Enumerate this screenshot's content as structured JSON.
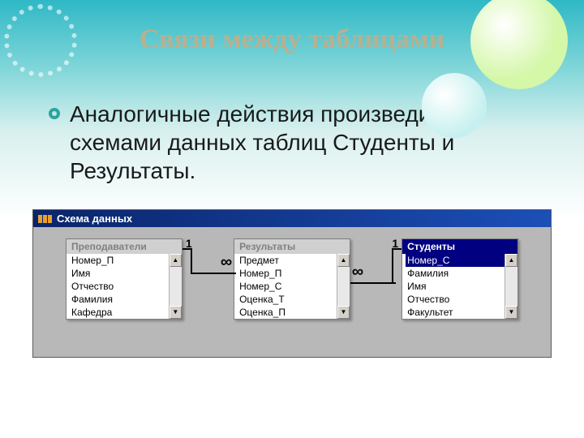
{
  "slide": {
    "title": "Связи между таблицами",
    "body": "Аналогичные действия произведите с схемами данных таблиц Студенты и Результаты."
  },
  "window": {
    "title": "Схема данных"
  },
  "tables": [
    {
      "name": "Преподаватели",
      "fields": [
        "Номер_П",
        "Имя",
        "Отчество",
        "Фамилия",
        "Кафедра"
      ],
      "selected": false
    },
    {
      "name": "Результаты",
      "fields": [
        "Предмет",
        "Номер_П",
        "Номер_С",
        "Оценка_Т",
        "Оценка_П"
      ],
      "selected": false
    },
    {
      "name": "Студенты",
      "fields": [
        "Номер_С",
        "Фамилия",
        "Имя",
        "Отчество",
        "Факультет"
      ],
      "selected": true,
      "selectedField": 0
    }
  ],
  "relations": [
    {
      "left_card": "1",
      "right_card": "∞"
    },
    {
      "left_card": "1",
      "right_card": "∞"
    }
  ],
  "scroll": {
    "up": "▲",
    "down": "▼"
  }
}
